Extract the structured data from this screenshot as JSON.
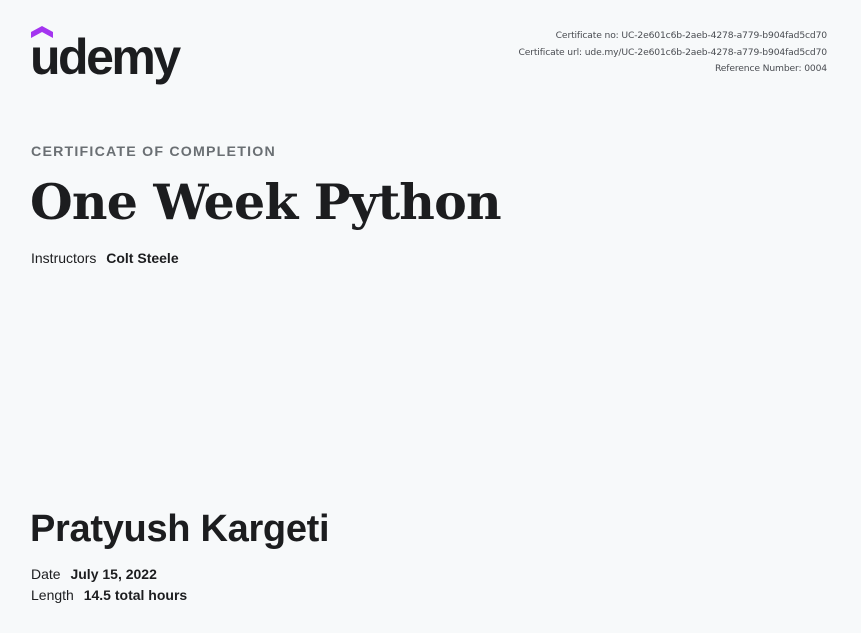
{
  "brand": {
    "logo_text": "udemy",
    "accent_color": "#a435f0"
  },
  "meta": {
    "certificate_no": "Certificate no: UC-2e601c6b-2aeb-4278-a779-b904fad5cd70",
    "certificate_url": "Certificate url: ude.my/UC-2e601c6b-2aeb-4278-a779-b904fad5cd70",
    "reference_number": "Reference Number: 0004"
  },
  "certificate": {
    "eyebrow": "CERTIFICATE OF COMPLETION",
    "course_title": "One Week Python",
    "instructors_label": "Instructors",
    "instructors_value": "Colt Steele"
  },
  "recipient": {
    "name": "Pratyush Kargeti"
  },
  "details": {
    "date_label": "Date",
    "date_value": "July 15, 2022",
    "length_label": "Length",
    "length_value": "14.5 total hours"
  }
}
